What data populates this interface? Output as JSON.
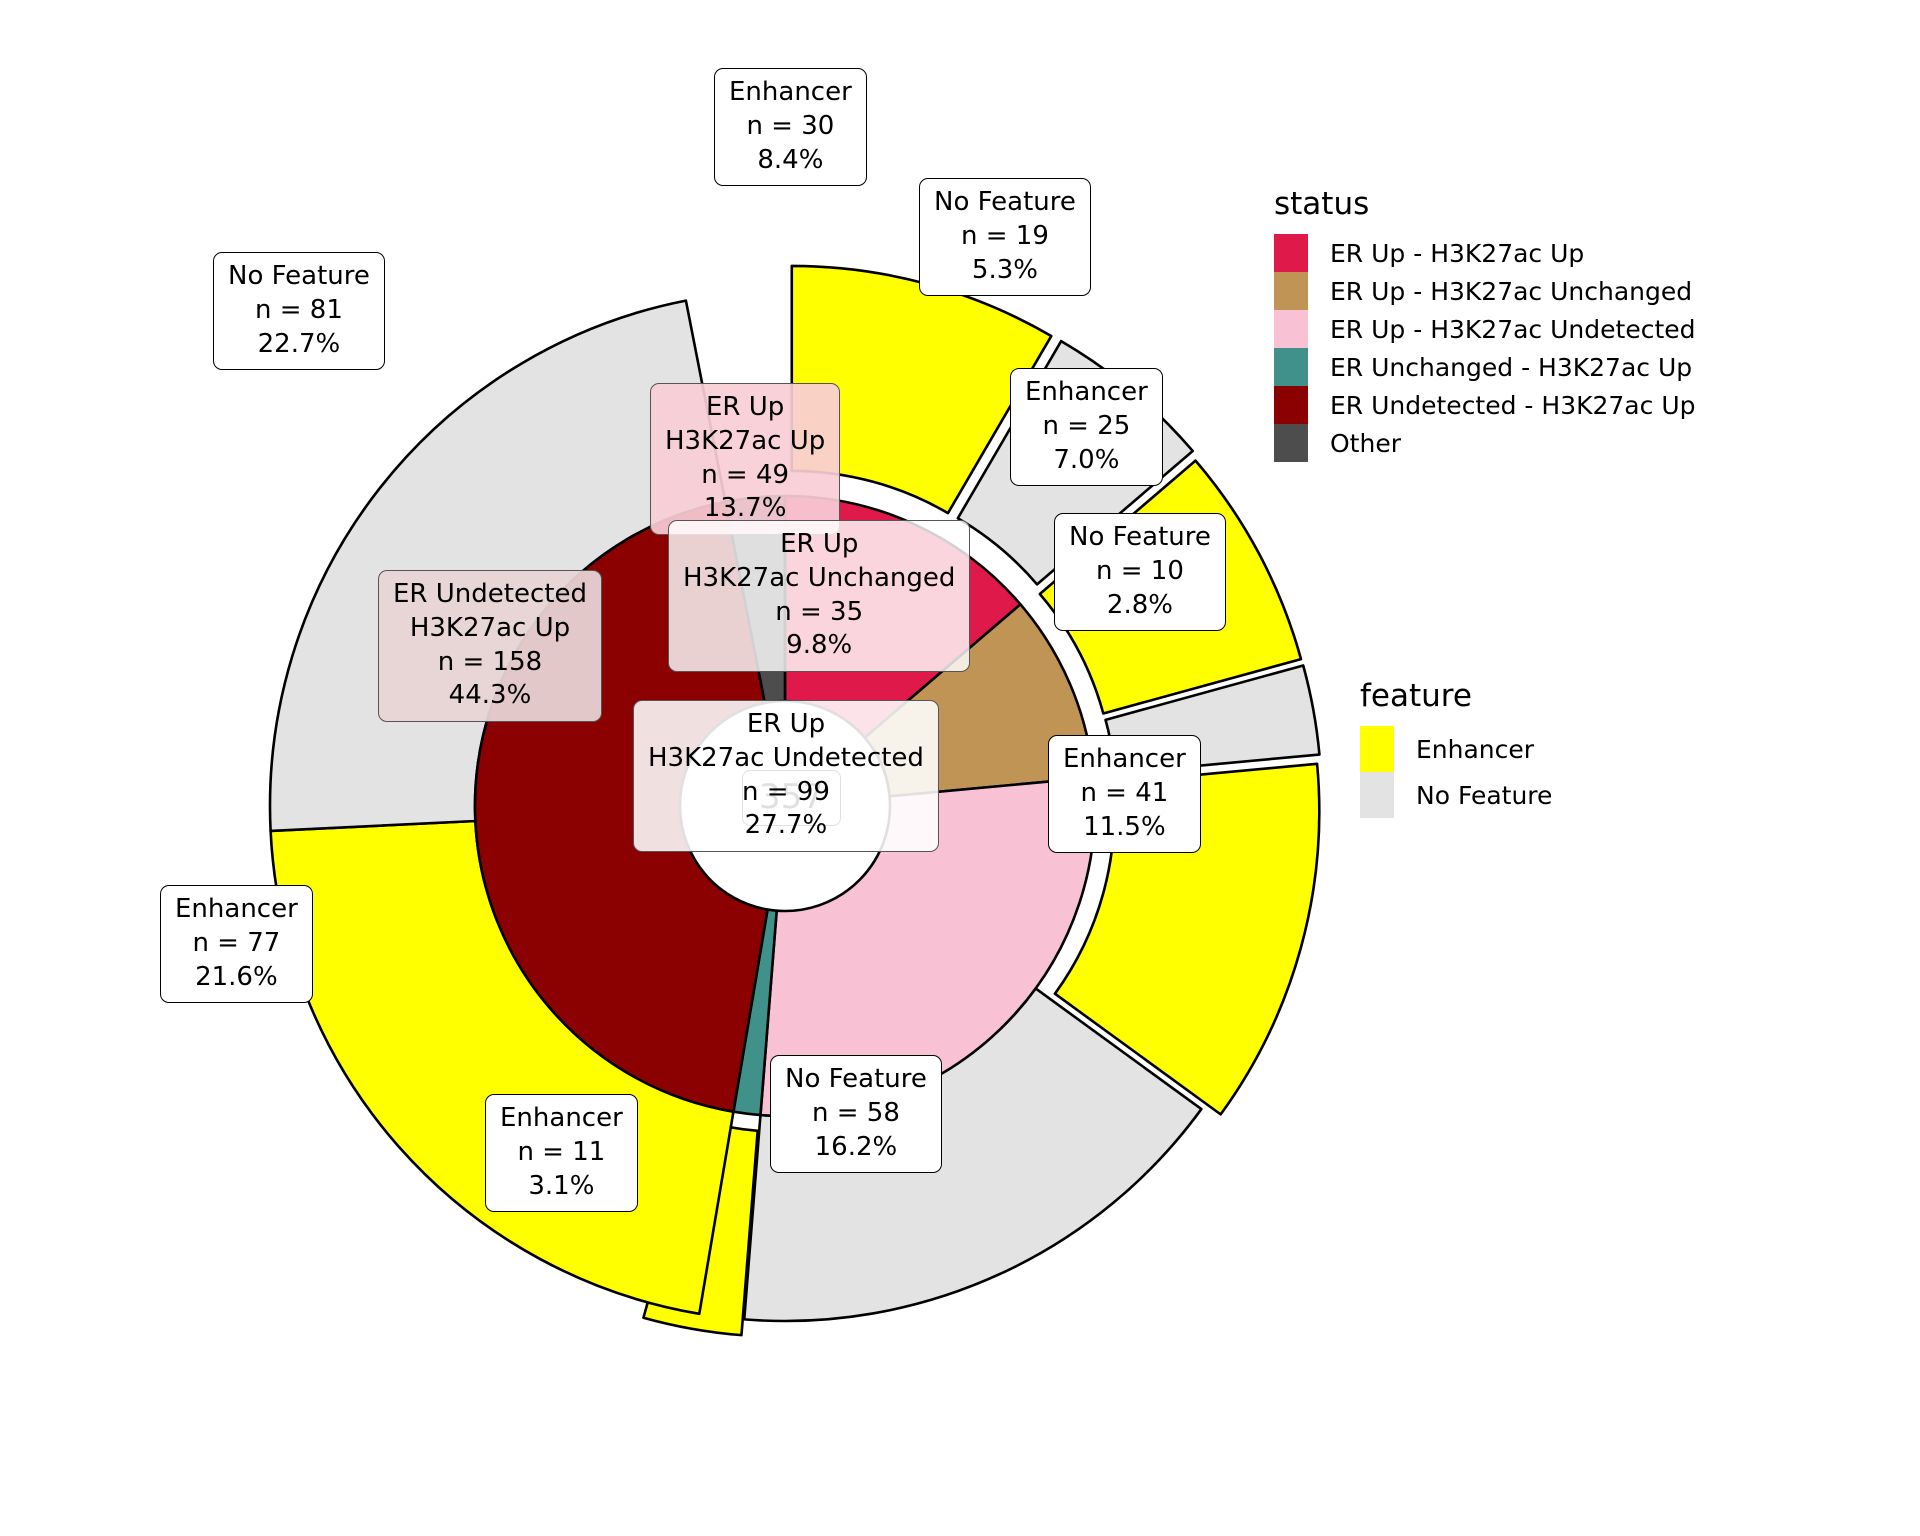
{
  "chart_data": {
    "type": "pie",
    "title": "",
    "total_label": "357",
    "total": 357,
    "grid": false,
    "legend_position": "right",
    "rings": [
      {
        "name": "status",
        "ring": "inner",
        "categories": [
          "ER Up - H3K27ac Up",
          "ER Up - H3K27ac Unchanged",
          "ER Up - H3K27ac Undetected",
          "ER Unchanged - H3K27ac Up",
          "ER Undetected - H3K27ac Up",
          "Other"
        ],
        "values": [
          49,
          35,
          99,
          5,
          158,
          11
        ],
        "percents": [
          "13.7%",
          "9.8%",
          "27.7%",
          "1.4%",
          "44.3%",
          "3.1%"
        ],
        "colors": [
          "#e0194b",
          "#bf9455",
          "#f8c1d4",
          "#3f9189",
          "#8b0000",
          "#4d4d4d"
        ]
      },
      {
        "name": "feature",
        "ring": "outer",
        "categories": [
          "Enhancer",
          "No Feature"
        ],
        "colors": [
          "#ffff00",
          "#e3e3e3"
        ],
        "values": [
          {
            "status": "ER Up - H3K27ac Up",
            "Enhancer": 30,
            "No Feature": 19
          },
          {
            "status": "ER Up - H3K27ac Unchanged",
            "Enhancer": 25,
            "No Feature": 10
          },
          {
            "status": "ER Up - H3K27ac Undetected",
            "Enhancer": 41,
            "No Feature": 58
          },
          {
            "status": "ER Unchanged - H3K27ac Up",
            "Enhancer": 11,
            "No Feature": 0
          },
          {
            "status": "ER Undetected - H3K27ac Up",
            "Enhancer": 77,
            "No Feature": 81
          }
        ]
      }
    ]
  },
  "center": {
    "value": "357"
  },
  "inner_labels": [
    {
      "l1": "ER Up",
      "l2": "H3K27ac Up",
      "n": "n = 49",
      "pct": "13.7%"
    },
    {
      "l1": "ER Up",
      "l2": "H3K27ac Unchanged",
      "n": "n = 35",
      "pct": "9.8%"
    },
    {
      "l1": "ER Up",
      "l2": "H3K27ac Undetected",
      "n": "n = 99",
      "pct": "27.7%"
    },
    {
      "l1": "ER Undetected",
      "l2": "H3K27ac Up",
      "n": "n = 158",
      "pct": "44.3%"
    }
  ],
  "outer_labels": [
    {
      "name": "Enhancer",
      "n": "n = 30",
      "pct": "8.4%"
    },
    {
      "name": "No Feature",
      "n": "n = 19",
      "pct": "5.3%"
    },
    {
      "name": "Enhancer",
      "n": "n = 25",
      "pct": "7.0%"
    },
    {
      "name": "No Feature",
      "n": "n = 10",
      "pct": "2.8%"
    },
    {
      "name": "Enhancer",
      "n": "n = 41",
      "pct": "11.5%"
    },
    {
      "name": "No Feature",
      "n": "n = 58",
      "pct": "16.2%"
    },
    {
      "name": "Enhancer",
      "n": "n = 11",
      "pct": "3.1%"
    },
    {
      "name": "Enhancer",
      "n": "n = 77",
      "pct": "21.6%"
    },
    {
      "name": "No Feature",
      "n": "n = 81",
      "pct": "22.7%"
    }
  ],
  "status_legend": {
    "title": "status",
    "items": [
      {
        "label": "ER Up - H3K27ac Up",
        "color": "#e0194b"
      },
      {
        "label": "ER Up - H3K27ac Unchanged",
        "color": "#bf9455"
      },
      {
        "label": "ER Up - H3K27ac Undetected",
        "color": "#f8c1d4"
      },
      {
        "label": "ER Unchanged - H3K27ac Up",
        "color": "#3f9189"
      },
      {
        "label": "ER Undetected - H3K27ac Up",
        "color": "#8b0000"
      },
      {
        "label": "Other",
        "color": "#4d4d4d"
      }
    ]
  },
  "feature_legend": {
    "title": "feature",
    "items": [
      {
        "label": "Enhancer",
        "color": "#ffff00"
      },
      {
        "label": "No Feature",
        "color": "#e3e3e3"
      }
    ]
  }
}
